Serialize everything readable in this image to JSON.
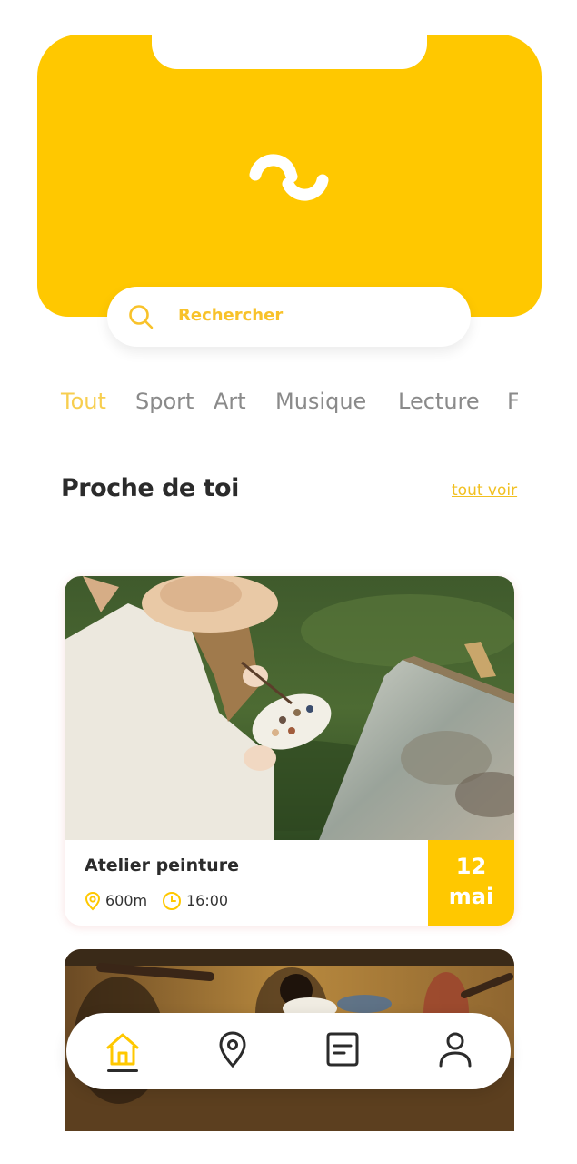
{
  "colors": {
    "accent": "#FFC800",
    "accent_text": "#F8C22A",
    "text_dark": "#2b2b2b",
    "text_muted": "#8a8a8a"
  },
  "search": {
    "placeholder": "Rechercher",
    "icon": "search-icon"
  },
  "categories": [
    {
      "label": "Tout",
      "active": true
    },
    {
      "label": "Sport",
      "active": false
    },
    {
      "label": "Art",
      "active": false
    },
    {
      "label": "Musique",
      "active": false
    },
    {
      "label": "Lecture",
      "active": false
    },
    {
      "label": "F",
      "active": false
    }
  ],
  "section": {
    "title": "Proche de toi",
    "see_all": "tout voir"
  },
  "events": [
    {
      "title": "Atelier peinture",
      "distance": "600m",
      "time": "16:00",
      "date_day": "12",
      "date_month": "mai",
      "image": "painting-photo"
    },
    {
      "image": "dance-photo"
    }
  ],
  "bottom_nav": [
    {
      "icon": "home-icon",
      "active": true
    },
    {
      "icon": "map-pin-icon",
      "active": false
    },
    {
      "icon": "message-icon",
      "active": false
    },
    {
      "icon": "user-icon",
      "active": false
    }
  ]
}
